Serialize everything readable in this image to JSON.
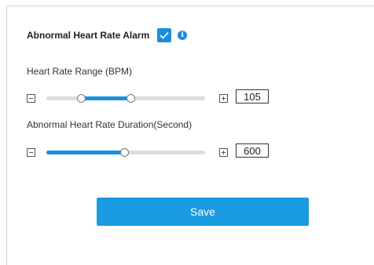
{
  "alarm": {
    "title": "Abnormal Heart Rate Alarm",
    "checked": true,
    "accent_color": "#1a8fe0",
    "info_icon": "info-icon"
  },
  "heart_rate_range": {
    "label": "Heart Rate Range (BPM)",
    "value": "105",
    "selected_range_fraction": [
      0.22,
      0.53
    ]
  },
  "duration": {
    "label": "Abnormal Heart Rate Duration(Second)",
    "value": "600",
    "level_fraction": 0.49
  },
  "save_label": "Save"
}
